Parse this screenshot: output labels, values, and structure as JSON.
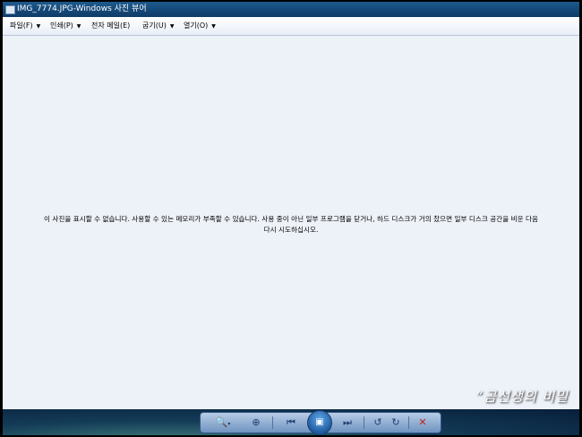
{
  "window": {
    "title": "IMG_7774.JPG-Windows 사진 뷰어"
  },
  "menu": {
    "items": [
      {
        "label": "파일(F)"
      },
      {
        "label": "인쇄(P)"
      },
      {
        "label": "전자 메일(E)"
      },
      {
        "label": "굽기(U)"
      },
      {
        "label": "열기(O)"
      }
    ]
  },
  "viewer": {
    "message_line1": "이 사진을 표시할 수 없습니다. 사용할 수 있는 메모리가 부족할 수 있습니다. 사용 중이 아닌 일부 프로그램을 닫거나, 하드 디스크가 거의 찼으면 일부 디스크 공간을 비운 다음",
    "message_line2": "다시 시도하십시오."
  },
  "controls": {
    "zoom_icon": "magnifier-icon",
    "fit_icon": "actual-size-icon",
    "previous_icon": "previous-icon",
    "slideshow_icon": "slideshow-icon",
    "next_icon": "next-icon",
    "rotate_ccw_icon": "rotate-counterclockwise-icon",
    "rotate_cw_icon": "rotate-clockwise-icon",
    "delete_icon": "delete-icon",
    "delete_color": "#c0221a"
  },
  "watermark": {
    "text": "“곰선생의 비밀"
  }
}
